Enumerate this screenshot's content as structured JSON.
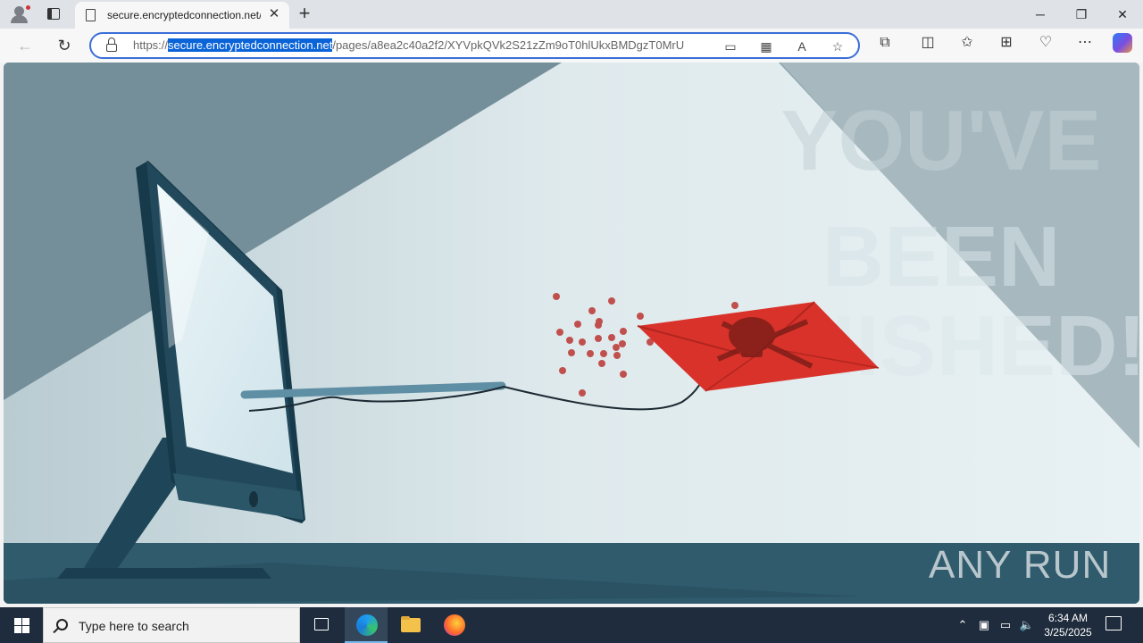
{
  "browser": {
    "tab": {
      "title": "secure.encryptedconnection.net/",
      "page_icon": "page-icon",
      "close_icon": "close-icon"
    },
    "new_tab_icon": "plus-icon",
    "window_controls": {
      "minimize": "─",
      "restore": "❐",
      "close": "✕"
    },
    "toolbar": {
      "back_icon": "arrow-left-icon",
      "refresh_icon": "refresh-icon",
      "url_scheme": "https://",
      "url_host": "secure.encryptedconnection.net",
      "url_path": "/pages/a8ea2c40a2f2/XYVpkQVk2S21zZm9oT0hlUkxBMDgzT0MrU",
      "omnibox_icons": [
        "device-icon",
        "grid-icon",
        "read-aloud-icon",
        "favorite-star-icon"
      ],
      "right_icons": [
        "extensions-icon",
        "split-screen-icon",
        "favorites-icon",
        "collections-icon",
        "browser-essentials-icon",
        "more-icon",
        "copilot-icon"
      ]
    }
  },
  "page": {
    "background_text": [
      "YOU'VE",
      "BEEN",
      "PHISHED!"
    ],
    "brand": "ANY RUN",
    "colors": {
      "envelope": "#d9322a",
      "envelope_dark": "#b0261f",
      "dots": "#c0504d",
      "monitor": "#1f4a5c",
      "floor": "#2e5a6c"
    }
  },
  "taskbar": {
    "search_placeholder": "Type here to search",
    "apps": [
      "task-view-icon",
      "edge-icon",
      "file-explorer-icon",
      "firefox-icon"
    ],
    "tray": [
      "chevron-up-icon",
      "meet-now-icon",
      "network-icon",
      "volume-icon"
    ],
    "time": "6:34 AM",
    "date": "3/25/2025"
  }
}
